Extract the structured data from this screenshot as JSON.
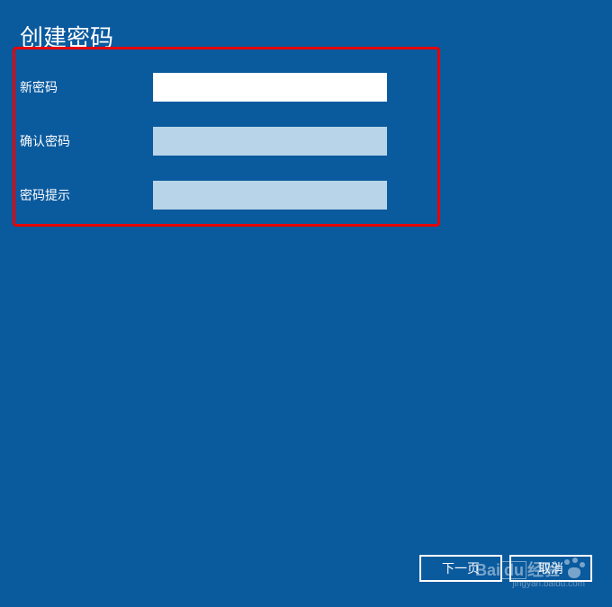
{
  "title": "创建密码",
  "fields": {
    "new_password": {
      "label": "新密码",
      "value": ""
    },
    "confirm_password": {
      "label": "确认密码",
      "value": ""
    },
    "password_hint": {
      "label": "密码提示",
      "value": ""
    }
  },
  "buttons": {
    "next": "下一页",
    "cancel": "取消"
  },
  "watermark": {
    "brand": "Bai",
    "brand_du": "du",
    "brand_suffix": "经验",
    "url": "jingyan.baidu.com"
  }
}
